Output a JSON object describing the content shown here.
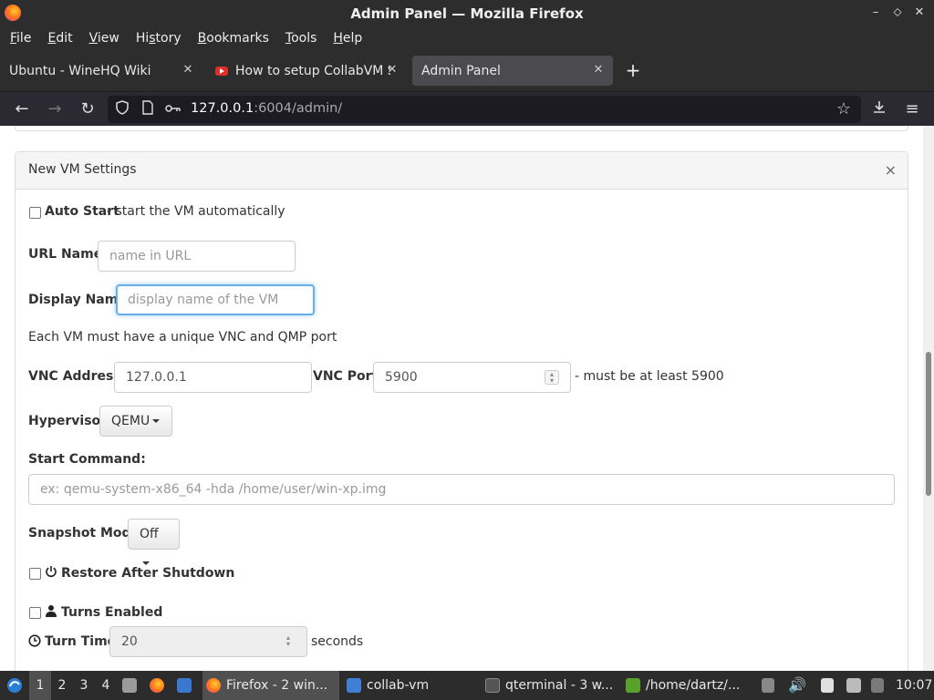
{
  "window": {
    "title": "Admin Panel — Mozilla Firefox",
    "controls": [
      "–",
      "⬦",
      "✕"
    ]
  },
  "menu": [
    {
      "label": "File",
      "u": "F",
      "rest": "ile"
    },
    {
      "label": "Edit",
      "u": "E",
      "rest": "dit"
    },
    {
      "label": "View",
      "u": "V",
      "rest": "iew"
    },
    {
      "label": "History",
      "pre": "Hi",
      "u": "s",
      "rest": "tory"
    },
    {
      "label": "Bookmarks",
      "u": "B",
      "rest": "ookmarks"
    },
    {
      "label": "Tools",
      "u": "T",
      "rest": "ools"
    },
    {
      "label": "Help",
      "u": "H",
      "rest": "elp"
    }
  ],
  "tabs": [
    {
      "label": "Ubuntu - WineHQ Wiki",
      "icon": "none"
    },
    {
      "label": "How to setup CollabVM S",
      "icon": "youtube-icon"
    },
    {
      "label": "Admin Panel",
      "icon": "none",
      "active": true
    }
  ],
  "nav": {
    "url_host": "127.0.0.1",
    "url_rest": ":6004/admin/"
  },
  "panel": {
    "title": "New VM Settings",
    "close": "×",
    "auto_start_label": "Auto Start",
    "auto_start_desc": "- start the VM automatically",
    "url_name_label": "URL Name:",
    "url_name_placeholder": "name in URL",
    "display_name_label": "Display Name:",
    "display_name_placeholder": "display name of the VM",
    "port_note": "Each VM must have a unique VNC and QMP port",
    "vnc_address_label": "VNC Address:",
    "vnc_address_value": "127.0.0.1",
    "vnc_port_label": "VNC Port:",
    "vnc_port_value": "5900",
    "vnc_port_note": "- must be at least 5900",
    "hypervisor_label": "Hypervisor:",
    "hypervisor_value": "QEMU",
    "start_command_label": "Start Command:",
    "start_command_placeholder": "ex: qemu-system-x86_64 -hda /home/user/win-xp.img",
    "snapshot_label": "Snapshot Mode:",
    "snapshot_value": "Off",
    "restore_label": "Restore After Shutdown",
    "turns_label": "Turns Enabled",
    "turn_time_label": "Turn Time:",
    "turn_time_value": "20",
    "turn_time_unit": "seconds"
  },
  "taskbar": {
    "workspaces": [
      "1",
      "2",
      "3",
      "4"
    ],
    "apps": [
      {
        "label": "Firefox - 2 win...",
        "icon": "firefox-icon"
      },
      {
        "label": "collab-vm",
        "icon": "folder-icon"
      },
      {
        "label": "qterminal - 3 w...",
        "icon": "terminal-icon"
      },
      {
        "label": "/home/dartz/...",
        "icon": "archive-icon"
      }
    ],
    "clock": "10:07"
  },
  "colors": {
    "chrome_dark": "#2d2d2d",
    "focus_blue": "#66afe9",
    "panel_heading": "#f5f5f5"
  }
}
